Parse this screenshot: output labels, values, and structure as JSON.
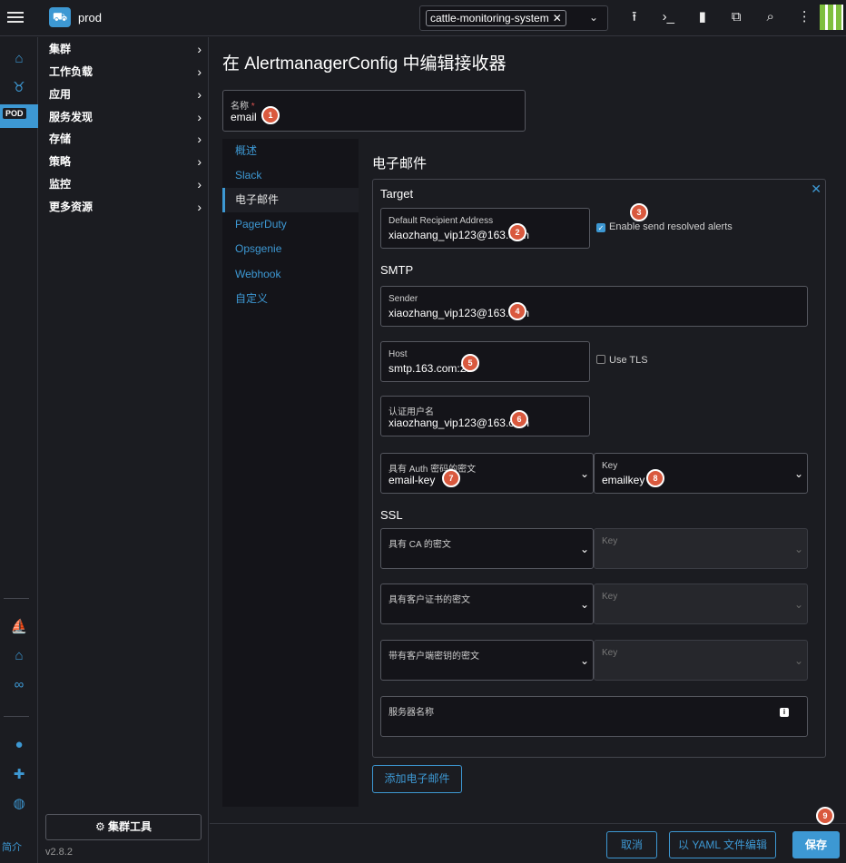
{
  "header": {
    "cluster_name": "prod",
    "namespace": "cattle-monitoring-system",
    "namespace_clear": "✕",
    "namespace_caret": "⌄",
    "icons": [
      "upload-icon",
      "shell-icon",
      "file-icon",
      "copy-icon",
      "search-icon",
      "more-vert-icon"
    ]
  },
  "rail": {
    "pod_label": "POD",
    "about": "简介"
  },
  "nav": {
    "groups": [
      "集群",
      "工作负载",
      "应用",
      "服务发现",
      "存储",
      "策略",
      "监控",
      "更多资源"
    ],
    "cluster_tools": "⚙ 集群工具",
    "version": "v2.8.2"
  },
  "page": {
    "title": "在 AlertmanagerConfig 中编辑接收器",
    "name_label": "名称",
    "name_required": "*",
    "name_value": "email"
  },
  "tabs": [
    "概述",
    "Slack",
    "电子邮件",
    "PagerDuty",
    "Opsgenie",
    "Webhook",
    "自定义"
  ],
  "email": {
    "section_title": "电子邮件",
    "close": "✕",
    "target_heading": "Target",
    "recipient_label": "Default Recipient Address",
    "recipient_value": "xiaozhang_vip123@163.com",
    "send_resolved_label": "Enable send resolved alerts",
    "send_resolved_checked": true,
    "smtp_heading": "SMTP",
    "sender_label": "Sender",
    "sender_value": "xiaozhang_vip123@163.com",
    "host_label": "Host",
    "host_value": "smtp.163.com:25",
    "use_tls_label": "Use TLS",
    "use_tls_checked": false,
    "auth_user_label": "认证用户名",
    "auth_user_value": "xiaozhang_vip123@163.com",
    "auth_secret_label": "具有 Auth 密码的密文",
    "auth_secret_value": "email-key",
    "auth_key_label": "Key",
    "auth_key_value": "emailkey",
    "ssl_heading": "SSL",
    "ca_secret_label": "具有 CA 的密文",
    "ca_key_label": "Key",
    "cert_secret_label": "具有客户证书的密文",
    "cert_key_label": "Key",
    "client_key_secret_label": "带有客户端密钥的密文",
    "client_key_key_label": "Key",
    "server_name_label": "服务器名称",
    "add_button": "添加电子邮件"
  },
  "footer": {
    "cancel": "取消",
    "edit_yaml": "以 YAML 文件编辑",
    "save": "保存"
  },
  "badges": [
    "1",
    "2",
    "3",
    "4",
    "5",
    "6",
    "7",
    "8",
    "9"
  ],
  "colors": {
    "accent": "#3d98d3",
    "badge": "#d9593e",
    "background": "#1b1c21"
  }
}
